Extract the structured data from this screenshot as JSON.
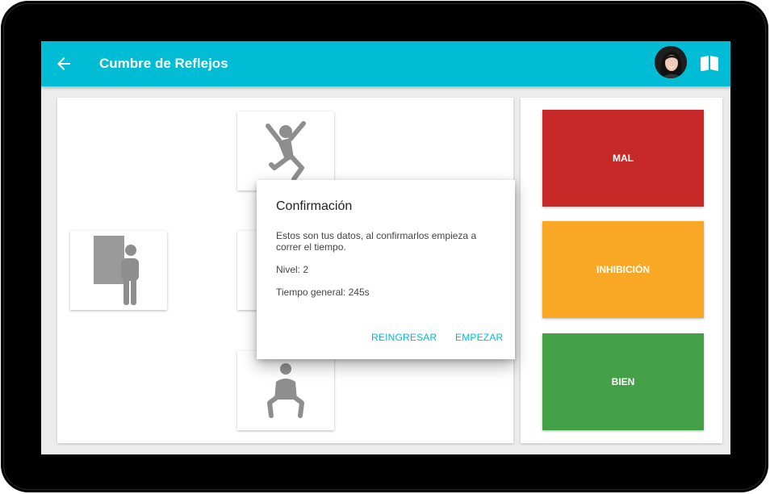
{
  "appbar": {
    "title": "Cumbre de Reflejos",
    "back_icon": "arrow-back-icon",
    "avatar_icon": "user-avatar",
    "book_icon": "open-book-icon",
    "color": "#00bcd4"
  },
  "tiles": [
    {
      "name": "jumping-person-icon"
    },
    {
      "name": "person-behind-door-icon"
    },
    {
      "name": "crouching-person-icon"
    }
  ],
  "dialog": {
    "title": "Confirmación",
    "message": "Estos son tus datos, al confirmarlos empieza a correr el tiempo.",
    "level": "Nivel: 2",
    "time": "Tiempo general: 245s",
    "reenter_label": "REINGRESAR",
    "start_label": "EMPEZAR"
  },
  "responses": [
    {
      "label": "MAL",
      "color": "#c62828"
    },
    {
      "label": "INHIBICIÓN",
      "color": "#f9a825"
    },
    {
      "label": "BIEN",
      "color": "#43a047"
    }
  ]
}
